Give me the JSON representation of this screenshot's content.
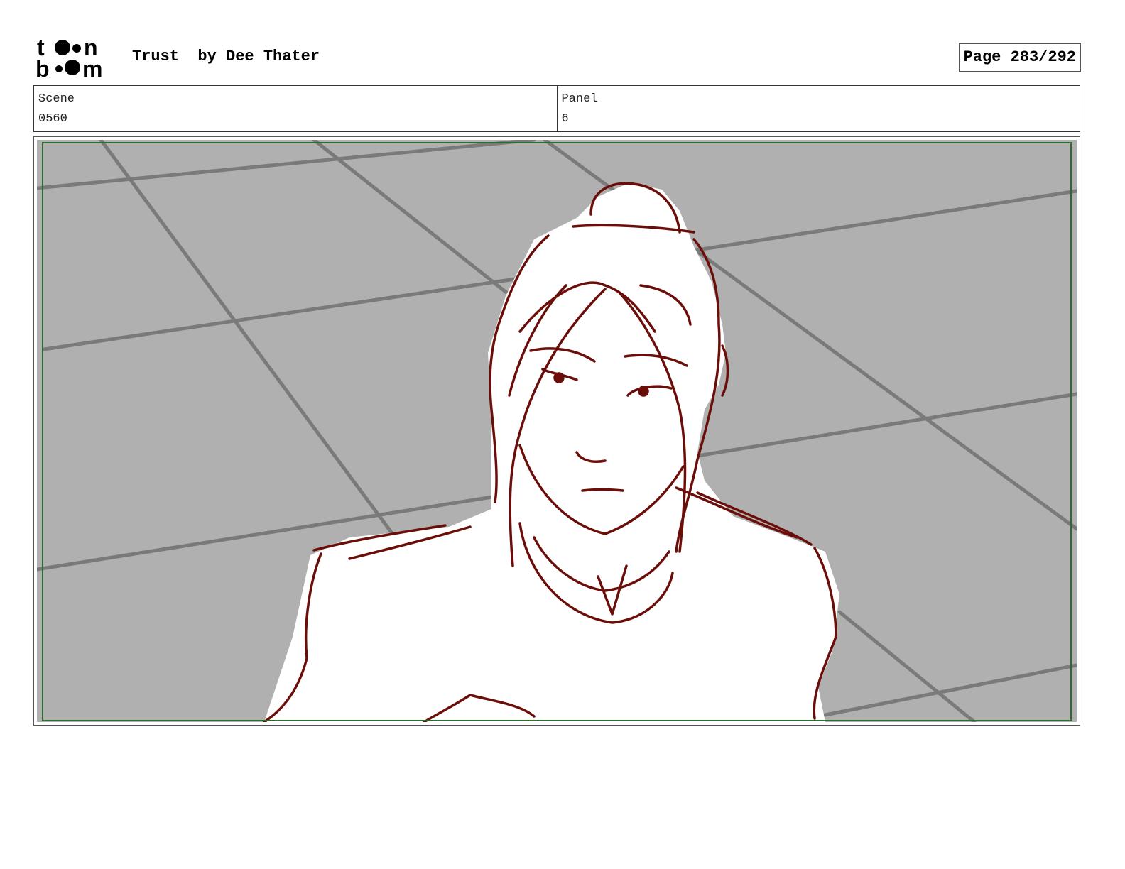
{
  "header": {
    "logo_text": "toon boom",
    "title": "Trust  by Dee Thater",
    "page_label": "Page 283/292"
  },
  "info": {
    "scene_label": "Scene",
    "scene_value": "0560",
    "panel_label": "Panel",
    "panel_value": "6"
  },
  "panel": {
    "background_color": "#b0b0b0",
    "tile_line_color": "#7a7a7a",
    "figure_line_color": "#6b0e0a",
    "safe_frame_color": "#2f6b2f"
  }
}
